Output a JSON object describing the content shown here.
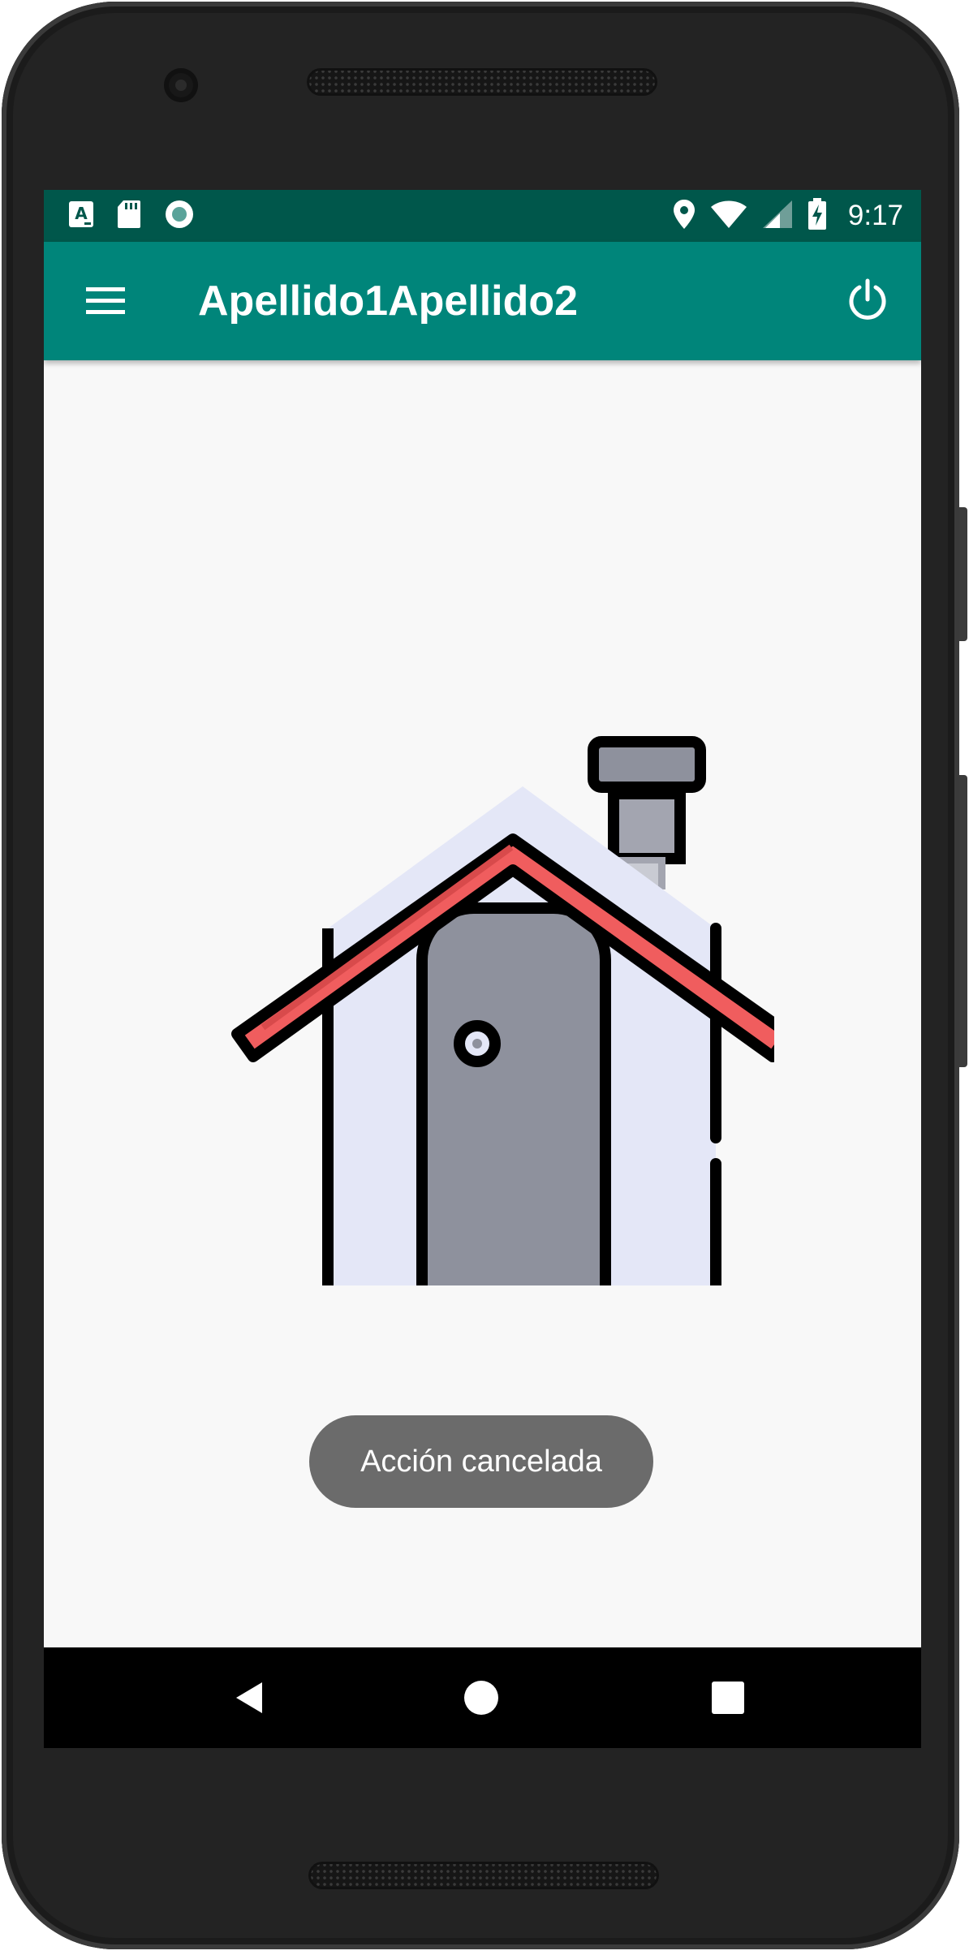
{
  "status_bar": {
    "time": "9:17",
    "left_icons": [
      "keyboard-a-icon",
      "sd-card-icon",
      "record-icon"
    ],
    "right_icons": [
      "location-icon",
      "wifi-icon",
      "signal-icon",
      "battery-charging-icon"
    ]
  },
  "toolbar": {
    "title": "Apellido1Apellido2",
    "background_color": "#00857a",
    "menu_icon": "hamburger-menu-icon",
    "action_icon": "power-icon"
  },
  "content": {
    "image": "house-icon"
  },
  "toast": {
    "message": "Acción cancelada"
  },
  "navigation_bar": {
    "buttons": [
      "back-icon",
      "home-icon",
      "recents-icon"
    ]
  },
  "colors": {
    "status_bar": "#00574b",
    "app_bar": "#00857a",
    "screen_background": "#f8f8f8",
    "roof": "#f05d5e",
    "wall": "#e4e7f7",
    "door": "#8e919d",
    "floor": "#00a2e5"
  }
}
